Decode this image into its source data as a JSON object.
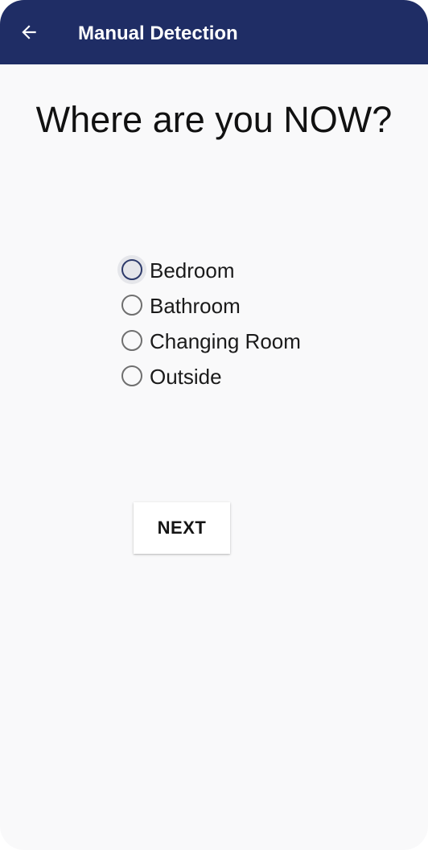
{
  "app_bar": {
    "back_icon": "arrow-left-icon",
    "title": "Manual Detection",
    "background_color": "#1f2d65"
  },
  "question": "Where are you NOW?",
  "options": [
    {
      "label": "Bedroom",
      "selected": false,
      "focused": true
    },
    {
      "label": "Bathroom",
      "selected": false,
      "focused": false
    },
    {
      "label": "Changing Room",
      "selected": false,
      "focused": false
    },
    {
      "label": "Outside",
      "selected": false,
      "focused": false
    }
  ],
  "next_button": {
    "label": "NEXT"
  }
}
